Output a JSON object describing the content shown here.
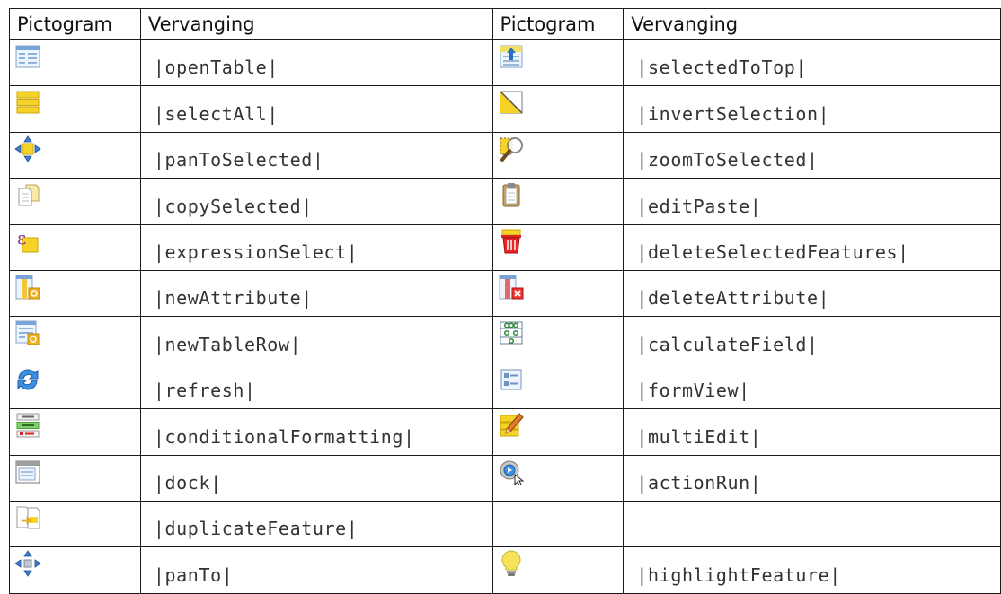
{
  "header": {
    "left_pictogram": "Pictogram",
    "left_replacement": "Vervanging",
    "right_pictogram": "Pictogram",
    "right_replacement": "Vervanging"
  },
  "rows": [
    {
      "left": {
        "icon": "open-table-icon",
        "text": "|openTable|"
      },
      "right": {
        "icon": "selected-to-top-icon",
        "text": "|selectedToTop|"
      }
    },
    {
      "left": {
        "icon": "select-all-icon",
        "text": "|selectAll|"
      },
      "right": {
        "icon": "invert-selection-icon",
        "text": "|invertSelection|"
      }
    },
    {
      "left": {
        "icon": "pan-to-selected-icon",
        "text": "|panToSelected|"
      },
      "right": {
        "icon": "zoom-to-selected-icon",
        "text": "|zoomToSelected|"
      }
    },
    {
      "left": {
        "icon": "copy-selected-icon",
        "text": "|copySelected|"
      },
      "right": {
        "icon": "edit-paste-icon",
        "text": "|editPaste|"
      }
    },
    {
      "left": {
        "icon": "expression-select-icon",
        "text": "|expressionSelect|"
      },
      "right": {
        "icon": "delete-selected-features-icon",
        "text": "|deleteSelectedFeatures|"
      }
    },
    {
      "left": {
        "icon": "new-attribute-icon",
        "text": "|newAttribute|"
      },
      "right": {
        "icon": "delete-attribute-icon",
        "text": "|deleteAttribute|"
      }
    },
    {
      "left": {
        "icon": "new-table-row-icon",
        "text": "|newTableRow|"
      },
      "right": {
        "icon": "calculate-field-icon",
        "text": "|calculateField|"
      }
    },
    {
      "left": {
        "icon": "refresh-icon",
        "text": "|refresh|"
      },
      "right": {
        "icon": "form-view-icon",
        "text": "|formView|"
      }
    },
    {
      "left": {
        "icon": "conditional-formatting-icon",
        "text": "|conditionalFormatting|"
      },
      "right": {
        "icon": "multi-edit-icon",
        "text": "|multiEdit|"
      }
    },
    {
      "left": {
        "icon": "dock-icon",
        "text": "|dock|"
      },
      "right": {
        "icon": "action-run-icon",
        "text": "|actionRun|"
      }
    },
    {
      "left": {
        "icon": "duplicate-feature-icon",
        "text": "|duplicateFeature|"
      },
      "right": {
        "icon": "",
        "text": ""
      }
    },
    {
      "left": {
        "icon": "pan-to-icon",
        "text": "|panTo|"
      },
      "right": {
        "icon": "highlight-feature-icon",
        "text": "|highlightFeature|"
      }
    }
  ]
}
